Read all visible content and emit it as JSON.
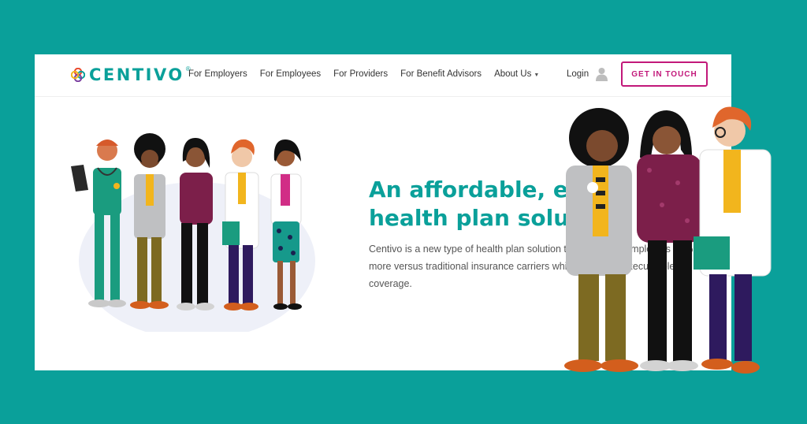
{
  "brand": {
    "name": "CENTIVO",
    "reg": "®"
  },
  "nav": {
    "links": [
      "For Employers",
      "For Employees",
      "For Providers",
      "For Benefit Advisors",
      "About Us"
    ],
    "login": "Login",
    "cta": "GET IN TOUCH"
  },
  "hero": {
    "title_line1": "An affordable, easy",
    "title_line2": "health plan solution",
    "text": "Centivo is a new type of health plan solution that can save employers 15% or more versus traditional insurance carriers while delivering executive-level coverage."
  },
  "colors": {
    "background": "#0aa09a",
    "accent": "#c2187a",
    "brand": "#0aa09a"
  },
  "icons": [
    "centivo-logo-icon",
    "user-icon",
    "chevron-down-icon"
  ]
}
